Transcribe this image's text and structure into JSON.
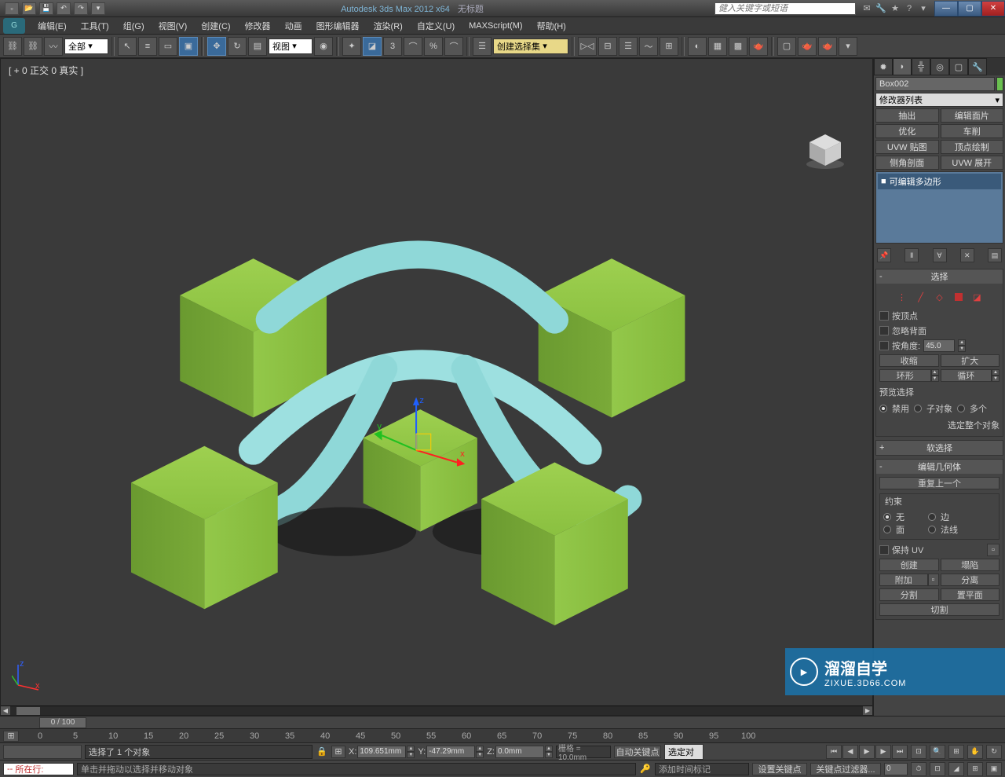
{
  "titlebar": {
    "app_title": "Autodesk 3ds Max  2012 x64",
    "doc_title": "无标题",
    "search_placeholder": "健入关键字或短语"
  },
  "menus": [
    "编辑(E)",
    "工具(T)",
    "组(G)",
    "视图(V)",
    "创建(C)",
    "修改器",
    "动画",
    "图形编辑器",
    "渲染(R)",
    "自定义(U)",
    "MAXScript(M)",
    "帮助(H)"
  ],
  "toolbar": {
    "filter_label": "全部",
    "view_label": "视图",
    "named_sel_label": "创建选择集"
  },
  "viewport": {
    "label": "[ + 0 正交 0 真实  ]"
  },
  "right_panel": {
    "object_name": "Box002",
    "modifier_list_label": "修改器列表",
    "modifier_buttons": [
      "抽出",
      "编辑面片",
      "优化",
      "车削",
      "UVW 贴图",
      "顶点绘制",
      "侧角剖面",
      "UVW 展开"
    ],
    "stack_item": "可编辑多边形",
    "rollouts": {
      "selection": {
        "title": "选择",
        "by_vertex": "按顶点",
        "ignore_backfacing": "忽略背面",
        "by_angle": "按角度:",
        "angle_value": "45.0",
        "shrink": "收缩",
        "grow": "扩大",
        "ring": "环形",
        "loop": "循环",
        "preview_label": "预览选择",
        "preview_off": "禁用",
        "preview_subobj": "子对象",
        "preview_multi": "多个",
        "whole_object": "选定整个对象"
      },
      "soft_sel": {
        "title": "软选择"
      },
      "edit_geo": {
        "title": "编辑几何体",
        "repeat_last": "重复上一个",
        "constraints": "约束",
        "c_none": "无",
        "c_edge": "边",
        "c_face": "面",
        "c_normal": "法线",
        "preserve_uv": "保持 UV",
        "create": "创建",
        "collapse": "塌陷",
        "attach": "附加",
        "detach": "分离",
        "slice_plane_1": "分割",
        "slice_plane_2": "置平面",
        "slice": "切割"
      }
    }
  },
  "timeline": {
    "frames": "0 / 100",
    "ticks": [
      "0",
      "5",
      "10",
      "15",
      "20",
      "25",
      "30",
      "35",
      "40",
      "45",
      "50",
      "55",
      "60",
      "65",
      "70",
      "75",
      "80",
      "85",
      "90",
      "95",
      "100"
    ]
  },
  "status": {
    "selected": "选择了 1 个对象",
    "x": "109.651mm",
    "y": "-47.29mm",
    "z": "0.0mm",
    "grid": "栅格 = 10.0mm",
    "autokey": "自动关键点",
    "sel_filter": "选定对",
    "prompt_prefix": "所在行:",
    "prompt": "单击并拖动以选择并移动对象",
    "add_time_tag": "添加时间标记",
    "set_key": "设置关键点",
    "key_filters": "关键点过滤器..."
  },
  "watermark": {
    "brand": "溜溜自学",
    "url": "ZIXUE.3D66.COM"
  }
}
